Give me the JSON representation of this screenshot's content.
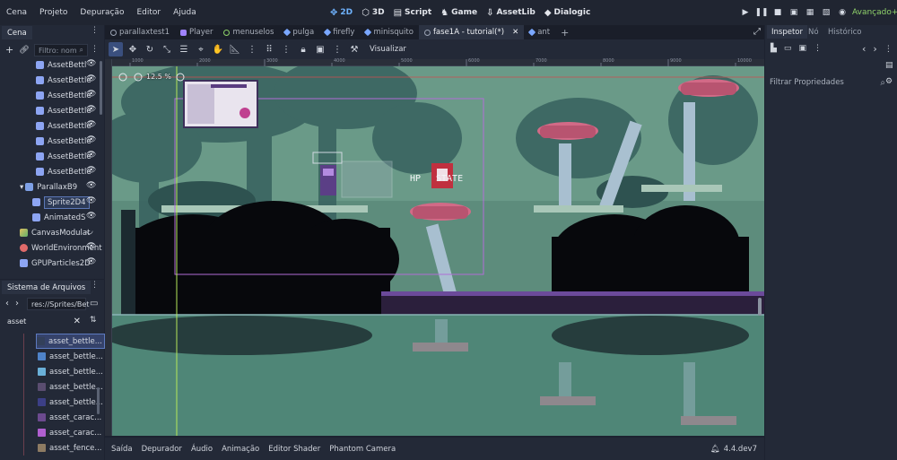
{
  "menubar": {
    "menus": [
      "Cena",
      "Projeto",
      "Depuração",
      "Editor",
      "Ajuda"
    ],
    "workspaces": [
      {
        "label": "2D",
        "icon": "2d-icon",
        "active": true
      },
      {
        "label": "3D",
        "icon": "3d-icon",
        "active": false
      },
      {
        "label": "Script",
        "icon": "script-icon",
        "active": false
      },
      {
        "label": "Game",
        "icon": "game-icon",
        "active": false
      },
      {
        "label": "AssetLib",
        "icon": "assetlib-icon",
        "active": false
      },
      {
        "label": "Dialogic",
        "icon": "dialogic-icon",
        "active": false
      }
    ],
    "renderer": "Avançado+"
  },
  "scene_dock": {
    "tab": "Cena",
    "filter_placeholder": "Filtro: nom",
    "nodes": [
      {
        "label": "AssetBettl",
        "type": "node2d"
      },
      {
        "label": "AssetBettle",
        "type": "node2d"
      },
      {
        "label": "AssetBettle",
        "type": "node2d"
      },
      {
        "label": "AssetBettle",
        "type": "node2d"
      },
      {
        "label": "AssetBettle",
        "type": "node2d"
      },
      {
        "label": "AssetBettle",
        "type": "node2d"
      },
      {
        "label": "AssetBettle",
        "type": "node2d"
      },
      {
        "label": "AssetBettle",
        "type": "node2d"
      },
      {
        "label": "ParallaxB9",
        "type": "parallax"
      },
      {
        "label": "Sprite2D4",
        "type": "sprite",
        "selected": true
      },
      {
        "label": "AnimatedS",
        "type": "node2d"
      },
      {
        "label": "CanvasModulat",
        "type": "canvas"
      },
      {
        "label": "WorldEnvironment",
        "type": "world"
      },
      {
        "label": "GPUParticles2D",
        "type": "node2d"
      }
    ]
  },
  "filesystem": {
    "tab": "Sistema de Arquivos",
    "path": "res://Sprites/Bet",
    "search": "asset",
    "files": [
      {
        "label": "asset_bettle...",
        "color": "#33405a",
        "selected": true
      },
      {
        "label": "asset_bettle...",
        "color": "#4f83c9"
      },
      {
        "label": "asset_bettle...",
        "color": "#6ab0d8"
      },
      {
        "label": "asset_bettle...",
        "color": "#5a4d70"
      },
      {
        "label": "asset_bettle...",
        "color": "#3c3f86"
      },
      {
        "label": "asset_carac...",
        "color": "#6c4a8e"
      },
      {
        "label": "asset_carac...",
        "color": "#b05fd0"
      },
      {
        "label": "asset_fence...",
        "color": "#8d7b63"
      }
    ]
  },
  "editor": {
    "scene_tabs": [
      {
        "label": "parallaxtest1",
        "icon": "scene-icon",
        "active": false
      },
      {
        "label": "Player",
        "icon": "player-icon",
        "active": false
      },
      {
        "label": "menuselos",
        "icon": "scene-icon",
        "active": false
      },
      {
        "label": "pulga",
        "icon": "bug-icon",
        "active": false
      },
      {
        "label": "firefly",
        "icon": "bug-icon",
        "active": false
      },
      {
        "label": "minisquito",
        "icon": "bug-icon",
        "active": false
      },
      {
        "label": "fase1A - tutorial(*)",
        "icon": "scene-icon",
        "active": true
      },
      {
        "label": "ant",
        "icon": "bug-icon",
        "active": false
      }
    ],
    "toolbar_label": "Visualizar",
    "zoom": "12.5 %",
    "hud": {
      "hp": "HP",
      "state": "STATE"
    },
    "ruler_ticks": [
      "-1000",
      "1000",
      "2000",
      "3000",
      "4000",
      "5000",
      "6000",
      "7000",
      "8000",
      "9000",
      "10000"
    ]
  },
  "bottom_panel": {
    "tabs": [
      "Saída",
      "Depurador",
      "Áudio",
      "Animação",
      "Editor Shader",
      "Phantom Camera"
    ],
    "version": "4.4.dev7"
  },
  "inspector": {
    "tabs": [
      {
        "label": "Inspetor",
        "active": true
      },
      {
        "label": "Nó",
        "active": false
      },
      {
        "label": "Histórico",
        "active": false
      }
    ],
    "filter_placeholder": "Filtrar Propriedades"
  },
  "colors": {
    "accent": "#6fb3ff",
    "renderer": "#8fd16a",
    "panel": "#232937",
    "bg": "#1d2230"
  }
}
